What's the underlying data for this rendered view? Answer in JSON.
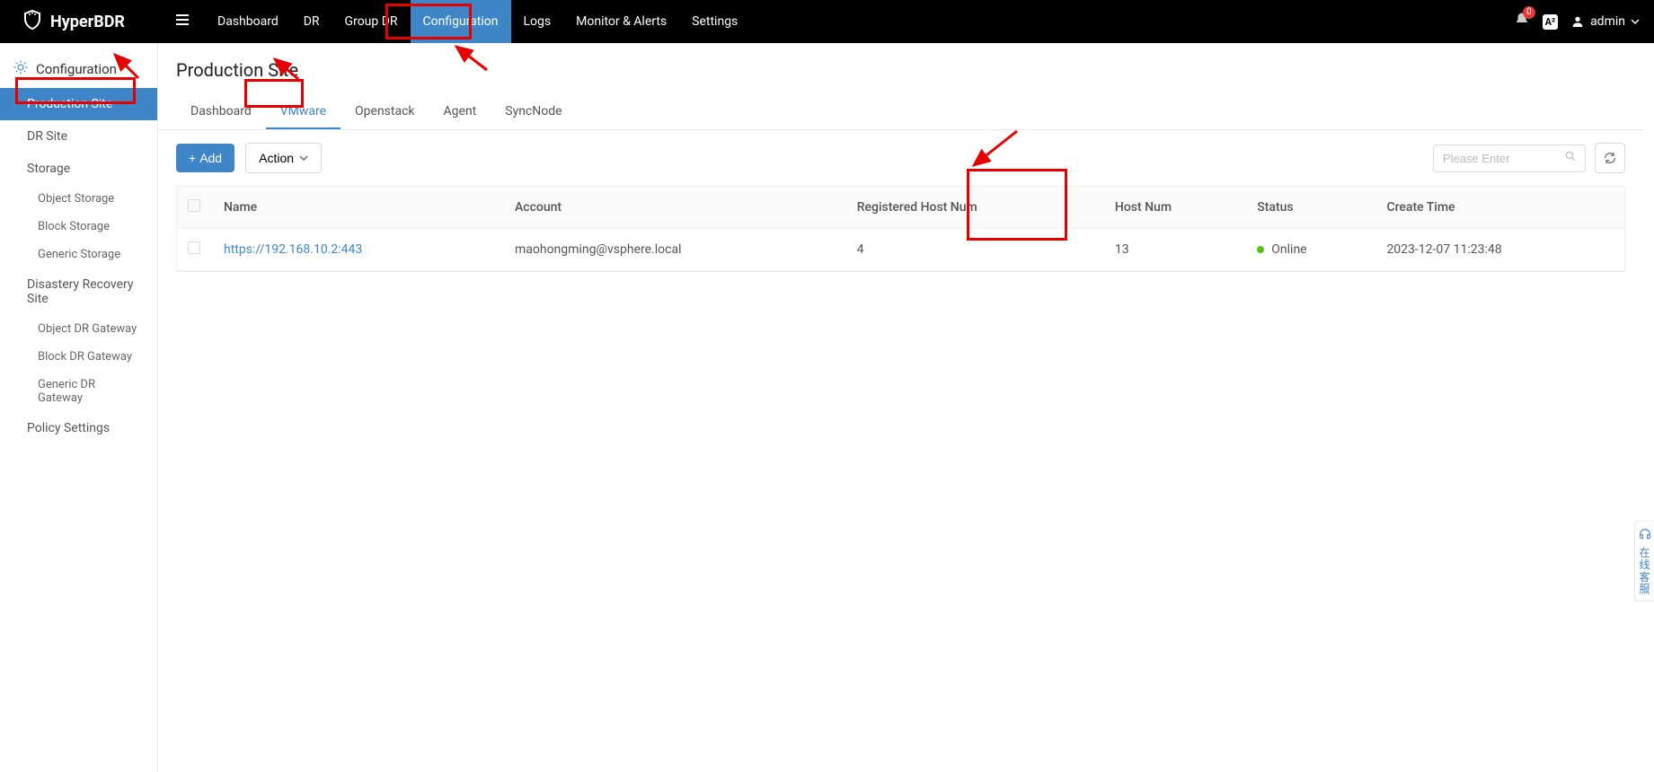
{
  "brand": "HyperBDR",
  "nav": {
    "items": [
      "Dashboard",
      "DR",
      "Group DR",
      "Configuration",
      "Logs",
      "Monitor & Alerts",
      "Settings"
    ],
    "activeIndex": 3,
    "bell_count": "0",
    "lang": "A²",
    "user": "admin"
  },
  "sidebar": {
    "heading": "Configuration",
    "groups": [
      {
        "type": "item",
        "label": "Production Site",
        "active": true
      },
      {
        "type": "item",
        "label": "DR Site"
      },
      {
        "type": "group",
        "label": "Storage"
      },
      {
        "type": "sub",
        "label": "Object Storage"
      },
      {
        "type": "sub",
        "label": "Block Storage"
      },
      {
        "type": "sub",
        "label": "Generic Storage"
      },
      {
        "type": "group",
        "label": "Disastery Recovery Site"
      },
      {
        "type": "sub",
        "label": "Object DR Gateway"
      },
      {
        "type": "sub",
        "label": "Block DR Gateway"
      },
      {
        "type": "sub",
        "label": "Generic DR Gateway"
      },
      {
        "type": "group",
        "label": "Policy Settings"
      }
    ]
  },
  "page_title": "Production Site",
  "tabs": [
    "Dashboard",
    "VMware",
    "Openstack",
    "Agent",
    "SyncNode"
  ],
  "tabs_activeIndex": 1,
  "toolbar": {
    "add_label": "Add",
    "action_label": "Action",
    "search_placeholder": "Please Enter"
  },
  "columns": [
    "Name",
    "Account",
    "Registered Host Num",
    "Host Num",
    "Status",
    "Create Time"
  ],
  "rows": [
    {
      "name": "https://192.168.10.2:443",
      "account": "maohongming@vsphere.local",
      "registered": "4",
      "host_num": "13",
      "status": "Online",
      "create_time": "2023-12-07 11:23:48"
    }
  ],
  "side_widget": "在线客服"
}
